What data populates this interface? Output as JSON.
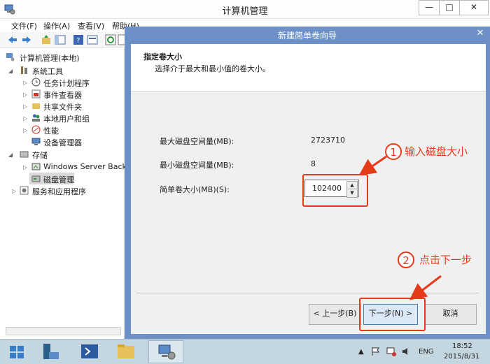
{
  "main_window": {
    "title": "计算机管理",
    "controls": {
      "minimize": "—",
      "maximize": "□",
      "close": "✕"
    },
    "menu": [
      "文件(F)",
      "操作(A)",
      "查看(V)",
      "帮助(H)"
    ]
  },
  "tree": {
    "root": "计算机管理(本地)",
    "system_tools": "系统工具",
    "task_scheduler": "任务计划程序",
    "event_viewer": "事件查看器",
    "shared_folders": "共享文件夹",
    "local_users": "本地用户和组",
    "performance": "性能",
    "device_manager": "设备管理器",
    "storage": "存储",
    "windows_backup": "Windows Server Back",
    "disk_management": "磁盘管理",
    "services": "服务和应用程序"
  },
  "wizard": {
    "title": "新建简单卷向导",
    "close": "✕",
    "header_title": "指定卷大小",
    "header_desc": "选择介于最大和最小值的卷大小。",
    "max_label": "最大磁盘空间量(MB):",
    "max_value": "2723710",
    "min_label": "最小磁盘空间量(MB):",
    "min_value": "8",
    "size_label": "简单卷大小(MB)(S):",
    "size_value": "102400",
    "back_button": "< 上一步(B)",
    "next_button": "下一步(N) >",
    "cancel_button": "取消"
  },
  "annotations": {
    "step1_num": "1",
    "step1_text": "输入磁盘大小",
    "step2_num": "2",
    "step2_text": "点击下一步",
    "color": "#e53b18"
  },
  "taskbar": {
    "language": "ENG",
    "time": "18:52",
    "date": "2015/8/31"
  }
}
